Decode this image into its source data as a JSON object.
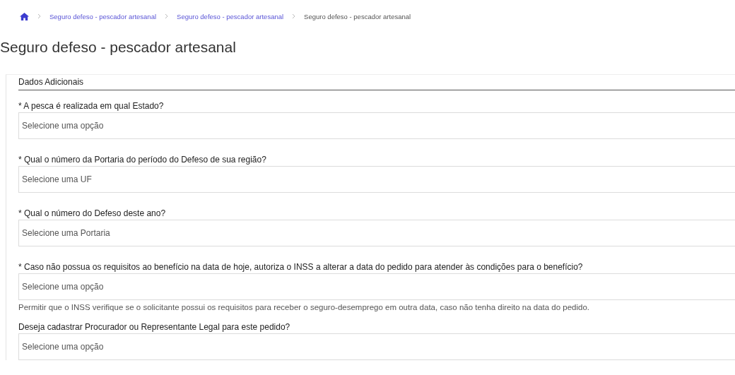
{
  "breadcrumb": [
    {
      "label": "Seguro defeso - pescador artesanal",
      "link": true
    },
    {
      "label": "Seguro defeso - pescador artesanal",
      "link": true
    },
    {
      "label": "Seguro defeso - pescador artesanal",
      "link": false
    }
  ],
  "title": "Seguro defeso - pescador artesanal",
  "section": {
    "heading": "Dados Adicionais",
    "fields": [
      {
        "label": "* A pesca é realizada em qual Estado?",
        "value": "Selecione uma opção"
      },
      {
        "label": "* Qual o número da Portaria do período do Defeso de sua região?",
        "value": "Selecione uma UF"
      },
      {
        "label": "* Qual o número do Defeso deste ano?",
        "value": "Selecione uma Portaria"
      },
      {
        "label": "* Caso não possua os requisitos ao benefício na data de hoje, autoriza o INSS a alterar a data do pedido para atender às condições para o benefício?",
        "value": "Selecione uma opção",
        "help": "Permitir que o INSS verifique se o solicitante possui os requisitos para receber o seguro-desemprego em outra data, caso não tenha direito na data do pedido."
      },
      {
        "label": "Deseja cadastrar Procurador ou Representante Legal para este pedido?",
        "value": "Selecione uma opção"
      }
    ]
  }
}
